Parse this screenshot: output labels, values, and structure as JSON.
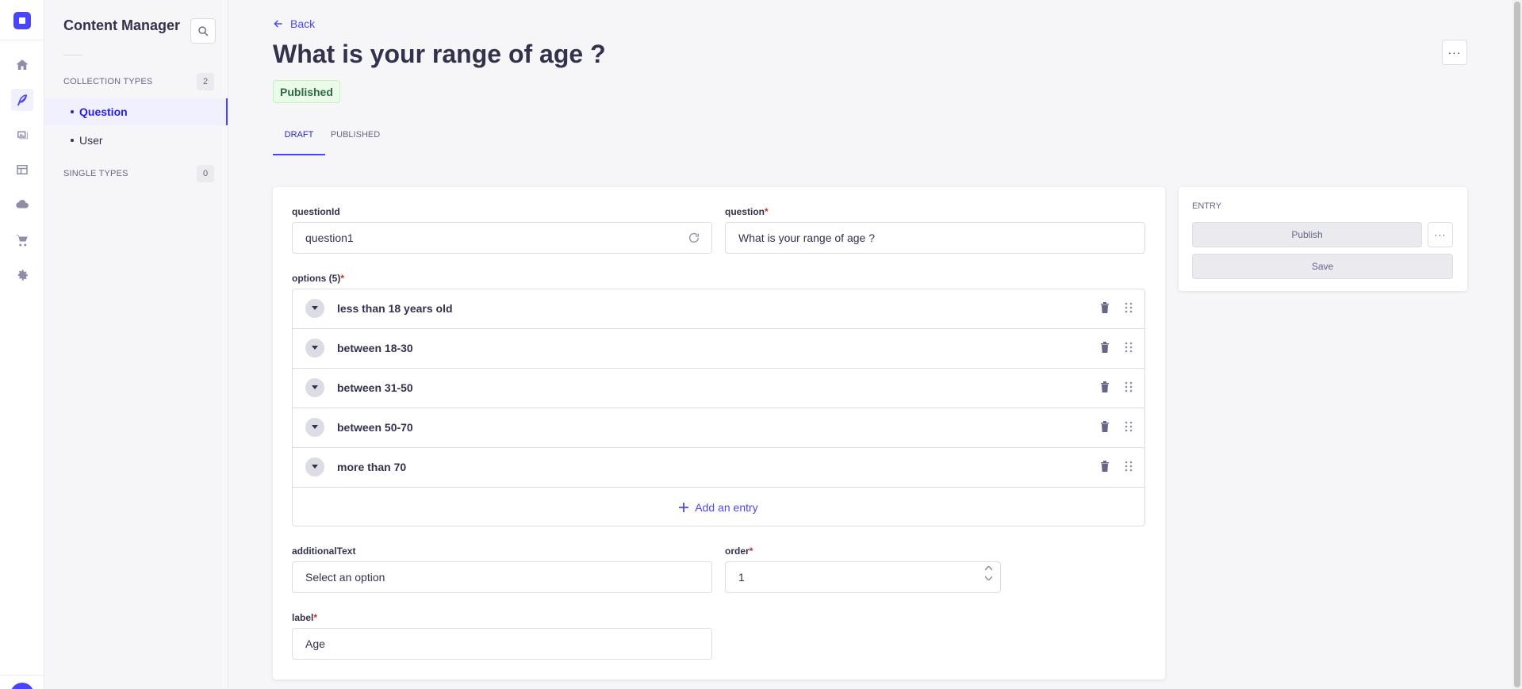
{
  "app": {
    "section_title": "Content Manager"
  },
  "sidebar": {
    "collection_types": {
      "label": "COLLECTION TYPES",
      "count": "2"
    },
    "items": [
      {
        "label": "Question",
        "active": true
      },
      {
        "label": "User",
        "active": false
      }
    ],
    "single_types": {
      "label": "SINGLE TYPES",
      "count": "0"
    }
  },
  "rail_icons": [
    "home-icon",
    "content-manager-icon",
    "media-library-icon",
    "content-type-builder-icon",
    "cloud-icon",
    "marketplace-icon",
    "settings-icon"
  ],
  "header": {
    "back_label": "Back",
    "title": "What is your range of age ?",
    "status": "Published"
  },
  "tabs": [
    {
      "label": "DRAFT",
      "active": true
    },
    {
      "label": "PUBLISHED",
      "active": false
    }
  ],
  "form": {
    "questionId": {
      "label": "questionId",
      "value": "question1"
    },
    "question": {
      "label": "question",
      "required": "*",
      "value": "What is your range of age ?"
    },
    "options": {
      "label": "options (5)",
      "required": "*",
      "items": [
        "less than 18 years old",
        "between 18-30",
        "between 31-50",
        "between 50-70",
        "more than 70"
      ],
      "add_label": "Add an entry"
    },
    "additionalText": {
      "label": "additionalText",
      "placeholder": "Select an option"
    },
    "order": {
      "label": "order",
      "required": "*",
      "value": "1"
    },
    "label": {
      "label": "label",
      "required": "*",
      "value": "Age"
    }
  },
  "side_panel": {
    "heading": "ENTRY",
    "publish_label": "Publish",
    "save_label": "Save"
  },
  "colors": {
    "accent": "#4945ff",
    "published_bg": "#eafbe7",
    "published_text": "#2f6846",
    "required": "#d02b20"
  }
}
